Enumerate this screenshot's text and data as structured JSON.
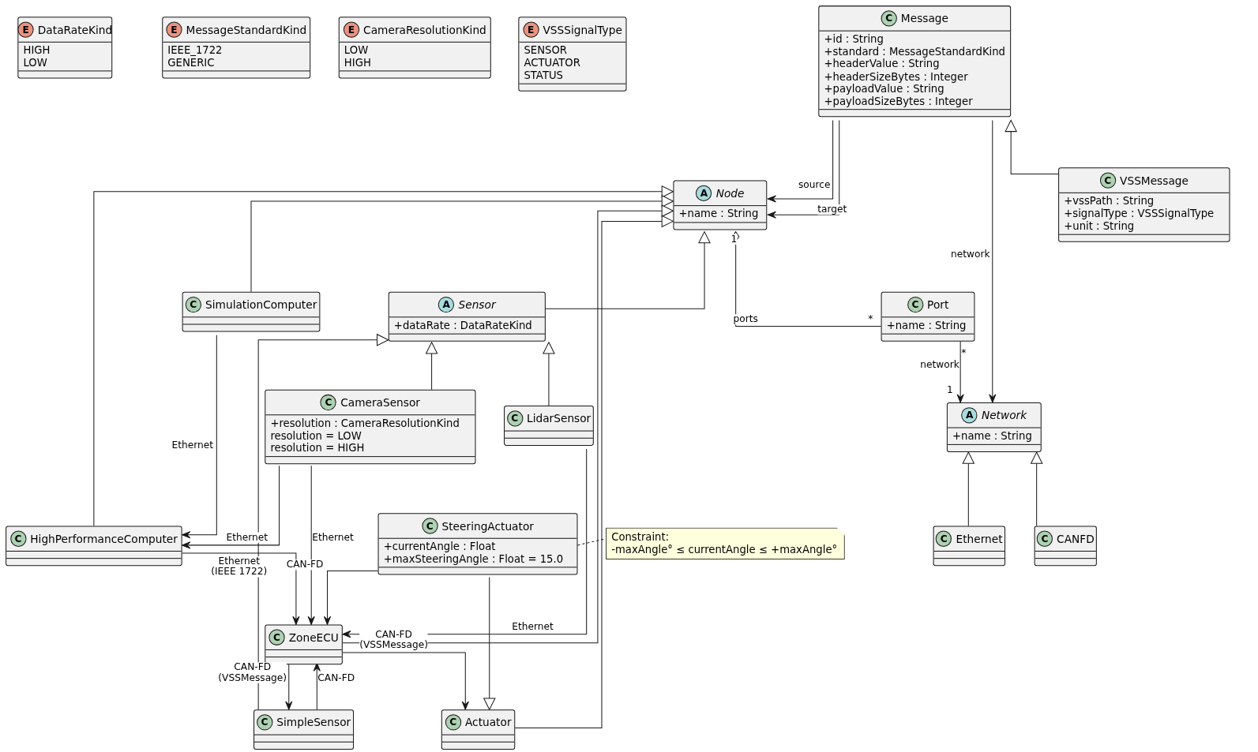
{
  "classes": [
    {
      "kind": "enum",
      "badge": "E",
      "name": "DataRateKind",
      "attributes": [
        "HIGH",
        "LOW"
      ]
    },
    {
      "kind": "enum",
      "badge": "E",
      "name": "MessageStandardKind",
      "attributes": [
        "IEEE_1722",
        "GENERIC"
      ]
    },
    {
      "kind": "enum",
      "badge": "E",
      "name": "CameraResolutionKind",
      "attributes": [
        "LOW",
        "HIGH"
      ]
    },
    {
      "kind": "enum",
      "badge": "E",
      "name": "VSSSignalType",
      "attributes": [
        "SENSOR",
        "ACTUATOR",
        "STATUS"
      ]
    },
    {
      "kind": "class",
      "badge": "C",
      "name": "Message",
      "attributes": [
        "+id : String",
        "+standard : MessageStandardKind",
        "+headerValue : String",
        "+headerSizeBytes : Integer",
        "+payloadValue : String",
        "+payloadSizeBytes : Integer"
      ]
    },
    {
      "kind": "abstract",
      "badge": "A",
      "name": "Node",
      "attributes": [
        "+name : String"
      ]
    },
    {
      "kind": "class",
      "badge": "C",
      "name": "VSSMessage",
      "attributes": [
        "+vssPath : String",
        "+signalType : VSSSignalType",
        "+unit : String"
      ]
    },
    {
      "kind": "class",
      "badge": "C",
      "name": "SimulationComputer"
    },
    {
      "kind": "abstract",
      "badge": "A",
      "name": "Sensor",
      "attributes": [
        "+dataRate : DataRateKind"
      ]
    },
    {
      "kind": "class",
      "badge": "C",
      "name": "Port",
      "attributes": [
        "+name : String"
      ]
    },
    {
      "kind": "class",
      "badge": "C",
      "name": "CameraSensor",
      "attributes": [
        "+resolution : CameraResolutionKind",
        "resolution = LOW",
        "resolution = HIGH"
      ]
    },
    {
      "kind": "class",
      "badge": "C",
      "name": "LidarSensor"
    },
    {
      "kind": "abstract",
      "badge": "A",
      "name": "Network",
      "attributes": [
        "+name : String"
      ]
    },
    {
      "kind": "class",
      "badge": "C",
      "name": "HighPerformanceComputer"
    },
    {
      "kind": "class",
      "badge": "C",
      "name": "SteeringActuator",
      "attributes": [
        "+currentAngle : Float",
        "+maxSteeringAngle : Float = 15.0"
      ]
    },
    {
      "kind": "class",
      "badge": "C",
      "name": "Ethernet"
    },
    {
      "kind": "class",
      "badge": "C",
      "name": "CANFD"
    },
    {
      "kind": "class",
      "badge": "C",
      "name": "ZoneECU"
    },
    {
      "kind": "class",
      "badge": "C",
      "name": "SimpleSensor"
    },
    {
      "kind": "class",
      "badge": "C",
      "name": "Actuator"
    }
  ],
  "note": {
    "lines": [
      "Constraint:",
      "-maxAngle° ≤ currentAngle ≤ +maxAngle°"
    ]
  },
  "relations": [
    {
      "kind": "association",
      "labels": [
        "source"
      ]
    },
    {
      "kind": "association",
      "labels": [
        "target"
      ]
    },
    {
      "kind": "association",
      "labels": [
        "network"
      ]
    },
    {
      "kind": "generalization"
    },
    {
      "kind": "generalization"
    },
    {
      "kind": "generalization"
    },
    {
      "kind": "generalization"
    },
    {
      "kind": "generalization"
    },
    {
      "kind": "generalization"
    },
    {
      "kind": "aggregation",
      "labels": [
        "1",
        "ports",
        "*"
      ]
    },
    {
      "kind": "association",
      "labels": [
        "*",
        "network",
        "1"
      ]
    },
    {
      "kind": "generalization"
    },
    {
      "kind": "generalization"
    },
    {
      "kind": "generalization"
    },
    {
      "kind": "generalization"
    },
    {
      "kind": "generalization"
    },
    {
      "kind": "association",
      "labels": [
        "Ethernet"
      ]
    },
    {
      "kind": "association",
      "labels": [
        "Ethernet"
      ]
    },
    {
      "kind": "association",
      "labels": [
        "Ethernet"
      ]
    },
    {
      "kind": "association",
      "labels": [
        "Ethernet\n(IEEE 1722)"
      ]
    },
    {
      "kind": "association",
      "labels": [
        "CAN-FD"
      ]
    },
    {
      "kind": "association",
      "labels": [
        "Ethernet"
      ]
    },
    {
      "kind": "association",
      "labels": [
        "CAN-FD\n(VSSMessage)"
      ]
    },
    {
      "kind": "generalization"
    },
    {
      "kind": "association",
      "labels": [
        "CAN-FD\n(VSSMessage)"
      ]
    },
    {
      "kind": "association",
      "labels": [
        "CAN-FD"
      ]
    }
  ]
}
